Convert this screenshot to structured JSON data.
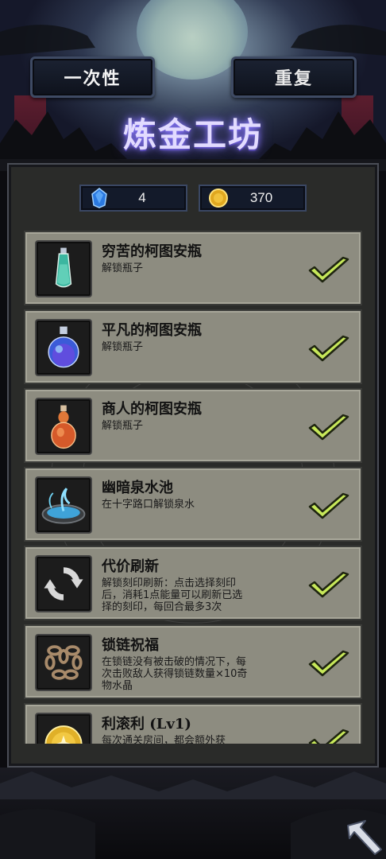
{
  "tabs": {
    "once_label": "一次性",
    "repeat_label": "重复"
  },
  "title": "炼金工坊",
  "currency": {
    "gems": {
      "icon": "blue-gem-icon",
      "value": "4"
    },
    "coins": {
      "icon": "gold-coin-icon",
      "value": "370"
    }
  },
  "items": [
    {
      "title": "穷苦的柯图安瓶",
      "desc": "解锁瓶子",
      "icon": "thin-bottle-icon",
      "unlocked": true
    },
    {
      "title": "平凡的柯图安瓶",
      "desc": "解锁瓶子",
      "icon": "round-flask-icon",
      "unlocked": true
    },
    {
      "title": "商人的柯图安瓶",
      "desc": "解锁瓶子",
      "icon": "gourd-flask-icon",
      "unlocked": true
    },
    {
      "title": "幽暗泉水池",
      "desc": "在十字路口解锁泉水",
      "icon": "fountain-icon",
      "unlocked": true
    },
    {
      "title": "代价刷新",
      "desc": "解锁刻印刷新：点击选择刻印后，消耗1点能量可以刷新已选择的刻印，每回合最多3次",
      "icon": "refresh-icon",
      "unlocked": true
    },
    {
      "title": "锁链祝福",
      "desc": "在锁链没有被击破的情况下，每次击败敌人获得锁链数量×10奇物水晶",
      "icon": "chain-icon",
      "unlocked": true
    },
    {
      "title": "利滚利 (Lv1)",
      "desc": "每次通关房间，都会额外获",
      "icon": "gold-coin-stack-icon",
      "unlocked": true
    }
  ],
  "colors": {
    "item_bg": "#8d8c80",
    "check_green": "#c7e85a",
    "title_glow": "#8b7cff"
  },
  "footer": {
    "back_icon": "back-arrow-icon"
  }
}
